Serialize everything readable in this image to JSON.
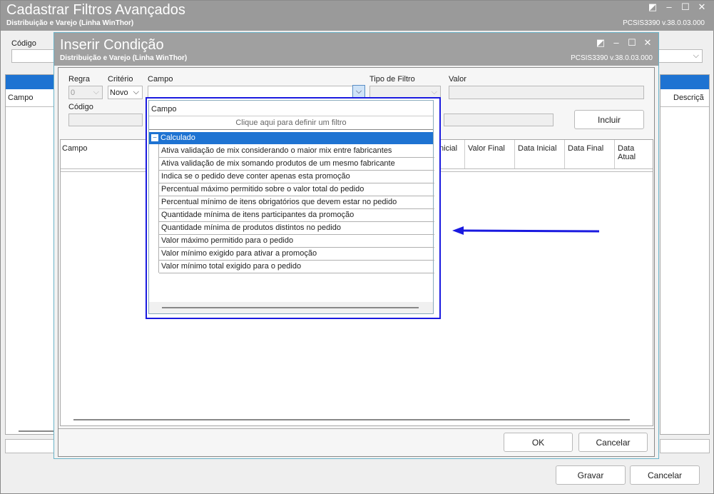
{
  "outer": {
    "title": "Cadastrar Filtros Avançados",
    "subtitle": "Distribuição e Varejo (Linha WinThor)",
    "version": "PCSIS3390  v.38.0.03.000",
    "codigo_label": "Código",
    "campo_header": "Campo",
    "descricao_header": "Descriçã",
    "gravar_label": "Gravar",
    "cancelar_label": "Cancelar"
  },
  "dialog": {
    "title": "Inserir Condição",
    "subtitle": "Distribuição e Varejo (Linha WinThor)",
    "version": "PCSIS3390  v.38.0.03.000",
    "regra_label": "Regra",
    "regra_value": "0",
    "criterio_label": "Critério",
    "criterio_value": "Novo",
    "campo_label": "Campo",
    "tipo_filtro_label": "Tipo de Filtro",
    "valor_label": "Valor",
    "codigo_label": "Código",
    "incluir_label": "Incluir",
    "ok_label": "OK",
    "cancelar_label": "Cancelar",
    "grid_headers": [
      "Campo",
      "Inicial",
      "Valor Final",
      "Data Inicial",
      "Data Final",
      "Data Atual"
    ]
  },
  "popup": {
    "column_header": "Campo",
    "filter_hint": "Clique aqui para definir um filtro",
    "group_label": "Calculado",
    "group_toggle": "−",
    "items": [
      "Ativa validação de mix considerando o maior mix entre fabricantes",
      "Ativa validação de mix somando produtos de um mesmo fabricante",
      "Indica se o pedido deve conter apenas esta promoção",
      "Percentual máximo permitido sobre o valor total do pedido",
      "Percentual mínimo de itens obrigatórios que devem estar no pedido",
      "Quantidade mínima de itens participantes da promoção",
      "Quantidade mínima de produtos distintos no pedido",
      "Valor máximo permitido para o pedido",
      "Valor mínimo exigido para ativar a promoção",
      "Valor mínimo total exigido para o pedido"
    ]
  },
  "colors": {
    "annotation": "#1a1ae0",
    "selected_row": "#1e73d2",
    "title_bar": "#9a9a9a"
  }
}
